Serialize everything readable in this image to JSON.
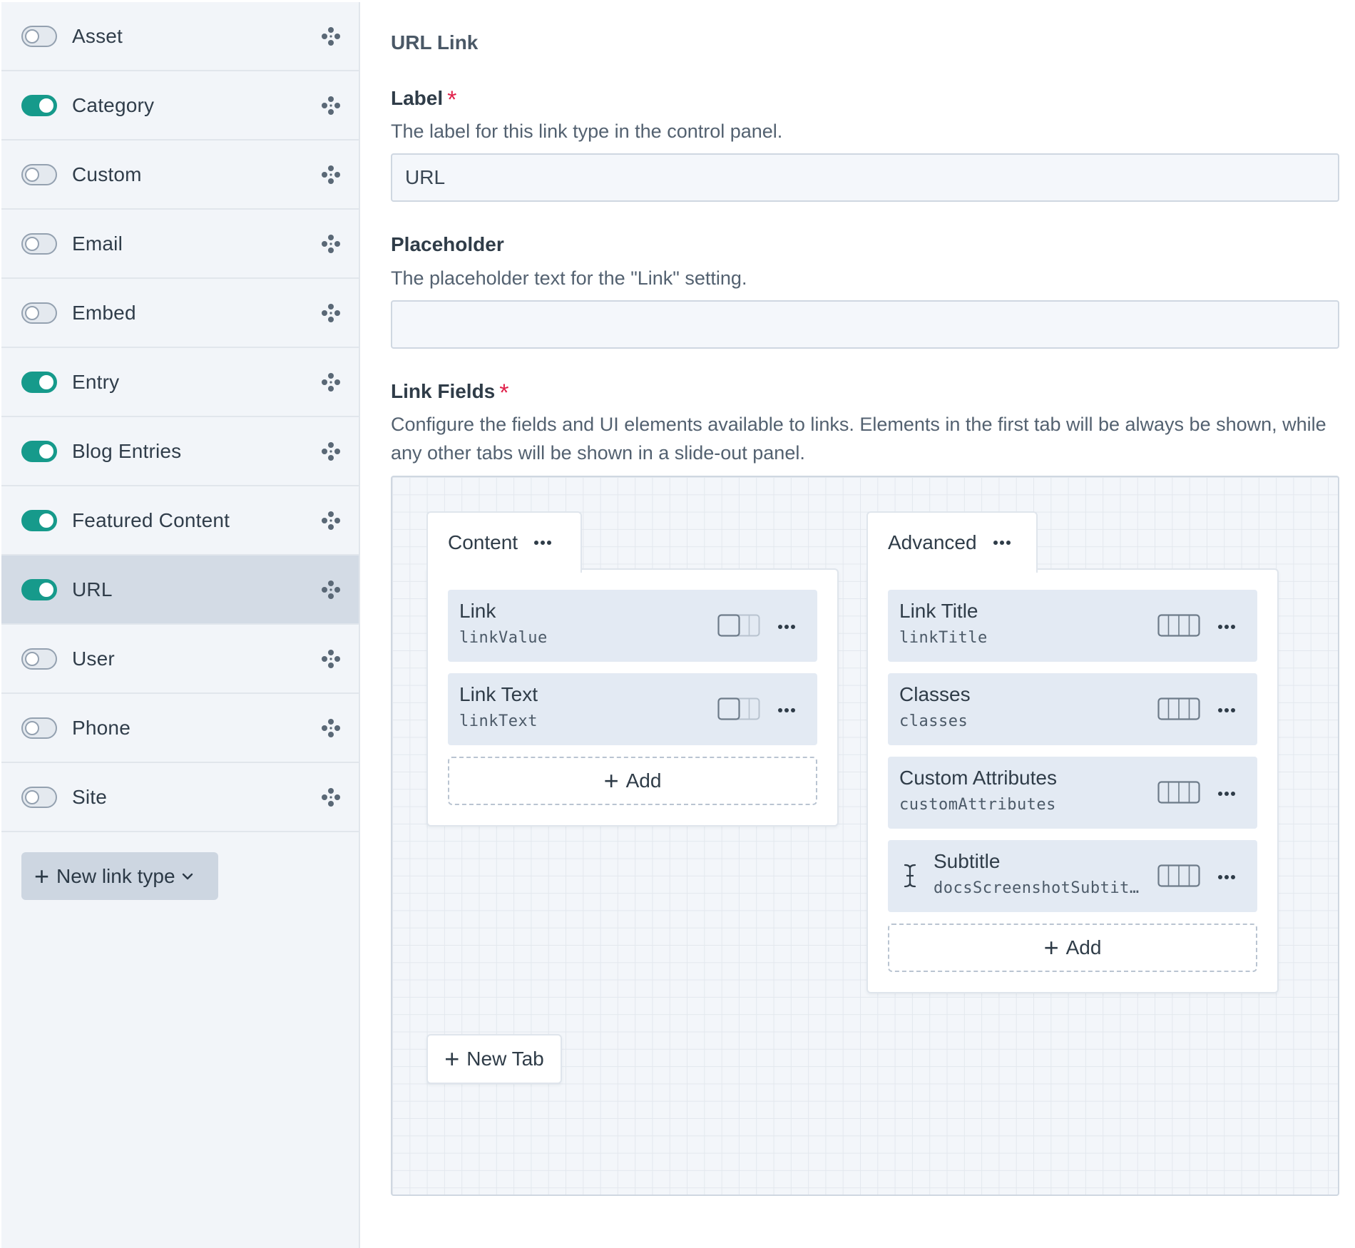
{
  "sidebar": {
    "items": [
      {
        "label": "Asset",
        "enabled": false,
        "selected": false
      },
      {
        "label": "Category",
        "enabled": true,
        "selected": false
      },
      {
        "label": "Custom",
        "enabled": false,
        "selected": false
      },
      {
        "label": "Email",
        "enabled": false,
        "selected": false
      },
      {
        "label": "Embed",
        "enabled": false,
        "selected": false
      },
      {
        "label": "Entry",
        "enabled": true,
        "selected": false
      },
      {
        "label": "Blog Entries",
        "enabled": true,
        "selected": false
      },
      {
        "label": "Featured Content",
        "enabled": true,
        "selected": false
      },
      {
        "label": "URL",
        "enabled": true,
        "selected": true
      },
      {
        "label": "User",
        "enabled": false,
        "selected": false
      },
      {
        "label": "Phone",
        "enabled": false,
        "selected": false
      },
      {
        "label": "Site",
        "enabled": false,
        "selected": false
      }
    ],
    "new_button_label": "New link type"
  },
  "main": {
    "title": "URL Link",
    "label_field": {
      "label": "Label",
      "required_marker": "*",
      "help": "The label for this link type in the control panel.",
      "value": "URL"
    },
    "placeholder_field": {
      "label": "Placeholder",
      "help": "The placeholder text for the \"Link\" setting.",
      "value": ""
    },
    "link_fields": {
      "label": "Link Fields",
      "required_marker": "*",
      "help": "Configure the fields and UI elements available to links. Elements in the first tab will be always be shown, while any other tabs will be shown in a slide-out panel."
    }
  },
  "designer": {
    "tabs": [
      {
        "name": "Content",
        "fields": [
          {
            "name": "Link",
            "handle": "linkValue"
          },
          {
            "name": "Link Text",
            "handle": "linkText"
          }
        ],
        "add_label": "Add"
      },
      {
        "name": "Advanced",
        "fields": [
          {
            "name": "Link Title",
            "handle": "linkTitle"
          },
          {
            "name": "Classes",
            "handle": "classes"
          },
          {
            "name": "Custom Attributes",
            "handle": "customAttributes"
          },
          {
            "name": "Subtitle",
            "handle": "docsScreenshotSubtit…"
          }
        ],
        "add_label": "Add"
      }
    ],
    "new_tab_label": "New Tab"
  },
  "colors": {
    "toggle_on": "#169a8b",
    "required": "#e0224b",
    "selected_row": "#d3dbe5"
  },
  "icons": {
    "move": "move-icon",
    "more": "ellipsis-icon",
    "width": "field-width-icon",
    "add": "plus-icon",
    "chevron": "chevron-down-icon"
  }
}
